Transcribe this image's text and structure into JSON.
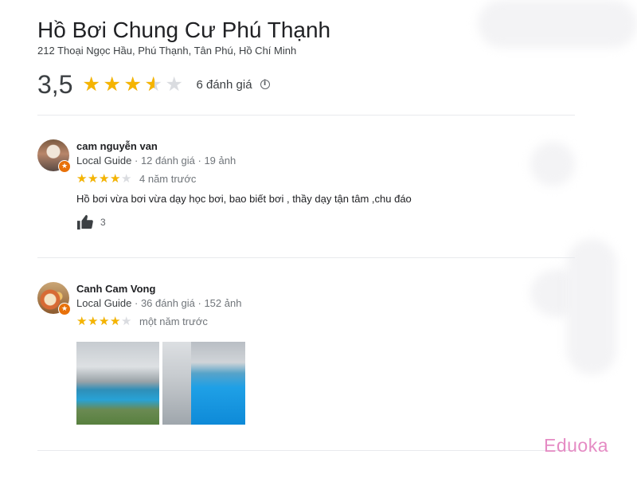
{
  "place": {
    "title": "Hồ Bơi Chung Cư Phú Thạnh",
    "address": "212 Thoại Ngọc Hầu, Phú Thạnh, Tân Phú, Hồ Chí Minh",
    "rating_value": "3,5",
    "rating": 3.5,
    "review_count": "6 đánh giá"
  },
  "reviews": [
    {
      "name": "cam nguyễn van",
      "guide_label": "Local Guide",
      "review_stats": " · 12 đánh giá · 19 ảnh",
      "rating": 4,
      "time": "4 năm trước",
      "text": "Hồ bơi vừa bơi vừa dạy học bơi, bao biết bơi , thầy dạy tận tâm ,chu đáo",
      "likes": "3"
    },
    {
      "name": "Canh Cam Vong",
      "guide_label": "Local Guide",
      "review_stats": " · 36 đánh giá · 152 ảnh",
      "rating": 4,
      "time": "một năm trước",
      "photo_count_shown": 2
    }
  ],
  "watermark": {
    "text": "Eduoka"
  },
  "icons": {
    "star": "star-icon",
    "info": "info-icon",
    "thumbs_up": "thumbs-up-icon",
    "local_guide": "local-guide-badge-icon"
  },
  "colors": {
    "star_filled": "#f5b400",
    "star_empty": "#dadce0",
    "guide_badge": "#e8710a",
    "watermark": "#e58bc4"
  }
}
